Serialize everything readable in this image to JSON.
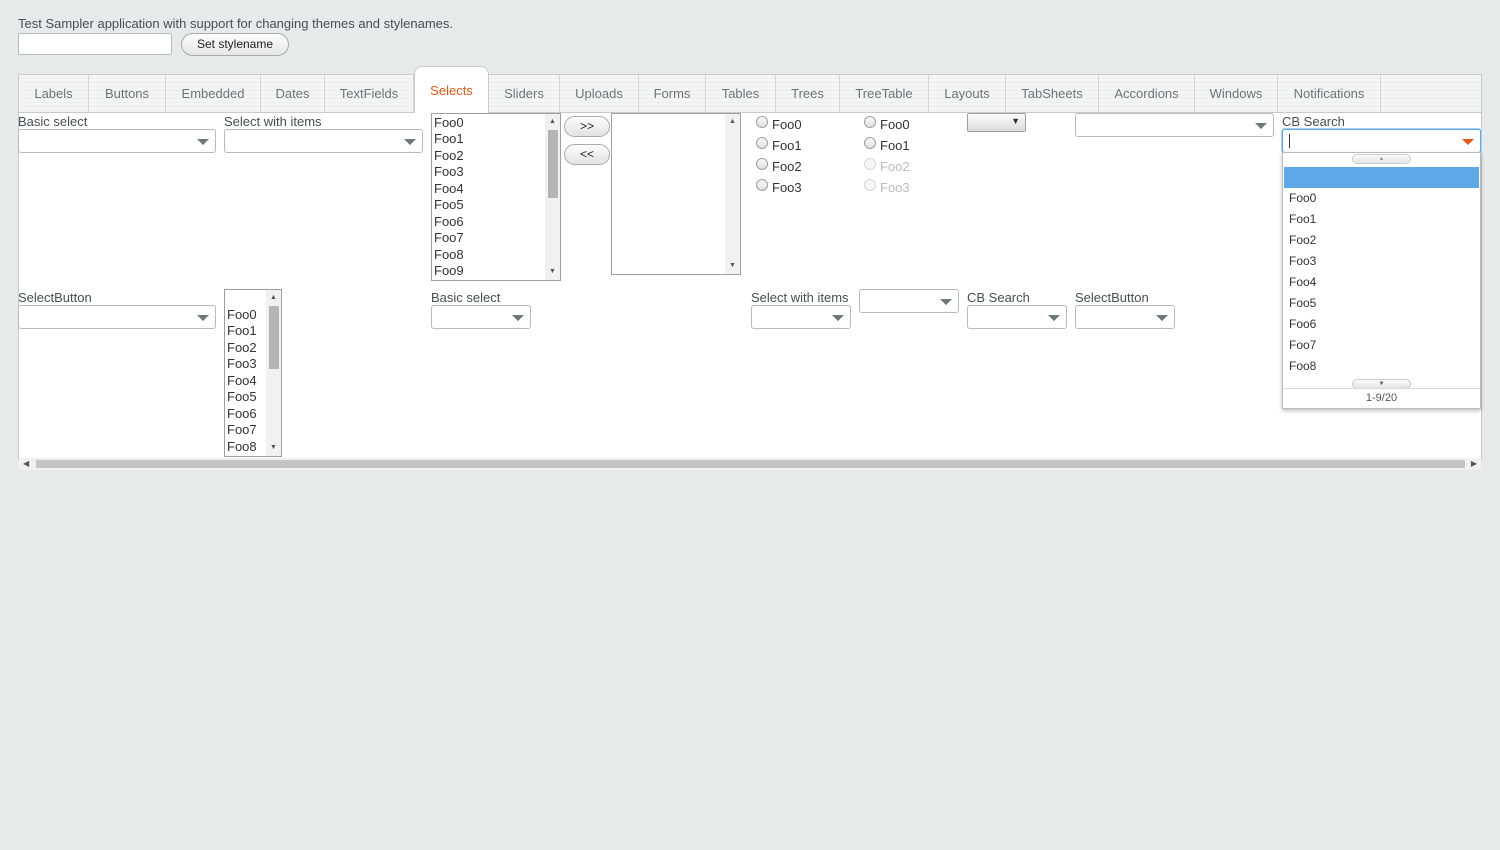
{
  "header": {
    "description": "Test Sampler application with support for changing themes and stylenames.",
    "stylename_input_value": "",
    "set_stylename_label": "Set stylename"
  },
  "tabs": [
    {
      "label": "Labels"
    },
    {
      "label": "Buttons"
    },
    {
      "label": "Embedded"
    },
    {
      "label": "Dates"
    },
    {
      "label": "TextFields"
    },
    {
      "label": "Selects",
      "selected": true
    },
    {
      "label": "Sliders"
    },
    {
      "label": "Uploads"
    },
    {
      "label": "Forms"
    },
    {
      "label": "Tables"
    },
    {
      "label": "Trees"
    },
    {
      "label": "TreeTable"
    },
    {
      "label": "Layouts"
    },
    {
      "label": "TabSheets"
    },
    {
      "label": "Accordions"
    },
    {
      "label": "Windows"
    },
    {
      "label": "Notifications"
    }
  ],
  "row1": {
    "basic_select_label": "Basic select",
    "select_with_items_label": "Select with items",
    "listselect_items": [
      "Foo0",
      "Foo1",
      "Foo2",
      "Foo3",
      "Foo4",
      "Foo5",
      "Foo6",
      "Foo7",
      "Foo8",
      "Foo9"
    ],
    "twincol_add": ">>",
    "twincol_remove": "<<",
    "option_group": [
      "Foo0",
      "Foo1",
      "Foo2",
      "Foo3"
    ],
    "option_group_disabled": [
      "Foo0",
      "Foo1",
      "Foo2",
      "Foo3"
    ],
    "cb_search_label": "CB Search",
    "cb_search_value": ""
  },
  "row2": {
    "selectbutton_label": "SelectButton",
    "list_items": [
      "Foo0",
      "Foo1",
      "Foo2",
      "Foo3",
      "Foo4",
      "Foo5",
      "Foo6",
      "Foo7",
      "Foo8"
    ],
    "basic_select_label": "Basic select",
    "select_with_items_label": "Select with items",
    "cb_search_label": "CB Search",
    "selectbutton2_label": "SelectButton"
  },
  "popup": {
    "items": [
      "Foo0",
      "Foo1",
      "Foo2",
      "Foo3",
      "Foo4",
      "Foo5",
      "Foo6",
      "Foo7",
      "Foo8"
    ],
    "status": "1-9/20"
  },
  "colors": {
    "accent": "#e05a1a",
    "highlight": "#5ea8e7",
    "background": "#e7eaeb"
  }
}
